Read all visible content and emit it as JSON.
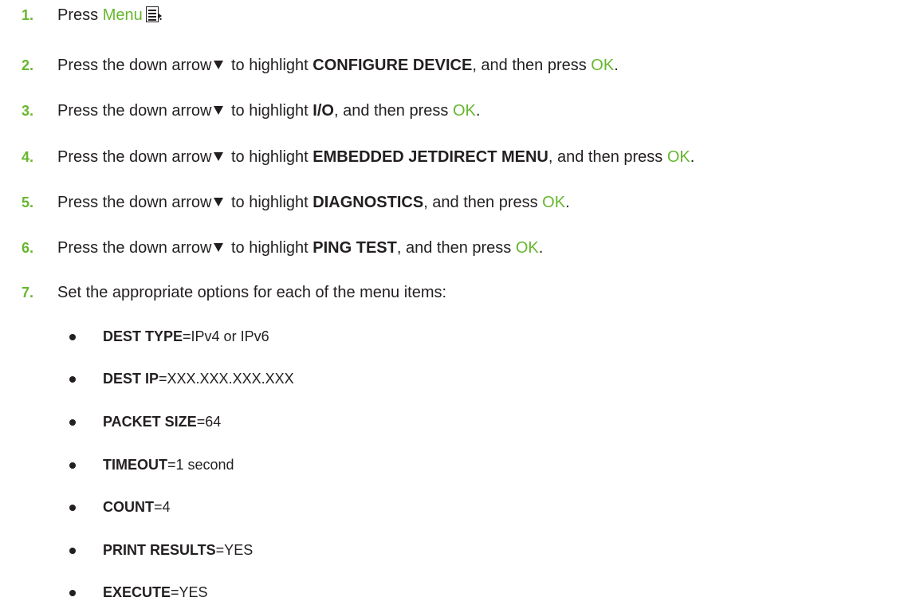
{
  "steps": [
    {
      "number": "1.",
      "prefix": "Press ",
      "link": "Menu",
      "suffix": ".",
      "icon": "menu-icon"
    },
    {
      "number": "2.",
      "prefix": "Press the down arrow",
      "bold": "CONFIGURE DEVICE",
      "press": "OK"
    },
    {
      "number": "3.",
      "prefix": "Press the down arrow",
      "bold": "I/O",
      "press": "OK"
    },
    {
      "number": "4.",
      "prefix": "Press the down arrow",
      "bold": "EMBEDDED JETDIRECT MENU",
      "press": "OK"
    },
    {
      "number": "5.",
      "prefix": "Press the down arrow",
      "bold": "DIAGNOSTICS",
      "press": "OK"
    },
    {
      "number": "6.",
      "prefix": "Press the down arrow",
      "bold": "PING TEST",
      "press": "OK"
    },
    {
      "number": "7.",
      "text": "Set the appropriate options for each of the menu items:"
    }
  ],
  "phrases": {
    "to_highlight": " to highlight ",
    "and_then_press": ", and then press ",
    "period": "."
  },
  "options": [
    {
      "label": "DEST TYPE",
      "value": "=IPv4 or IPv6"
    },
    {
      "label": "DEST IP",
      "value": "=XXX.XXX.XXX.XXX"
    },
    {
      "label": "PACKET SIZE",
      "value": "=64"
    },
    {
      "label": "TIMEOUT",
      "value": "=1 second"
    },
    {
      "label": "COUNT",
      "value": "=4"
    },
    {
      "label": "PRINT RESULTS",
      "value": "=YES"
    },
    {
      "label": "EXECUTE",
      "value": "=YES"
    }
  ],
  "colors": {
    "accent_green": "#66b72e",
    "text": "#231f20"
  },
  "icons": [
    "menu-icon",
    "down-arrow-icon",
    "bullet-icon"
  ]
}
